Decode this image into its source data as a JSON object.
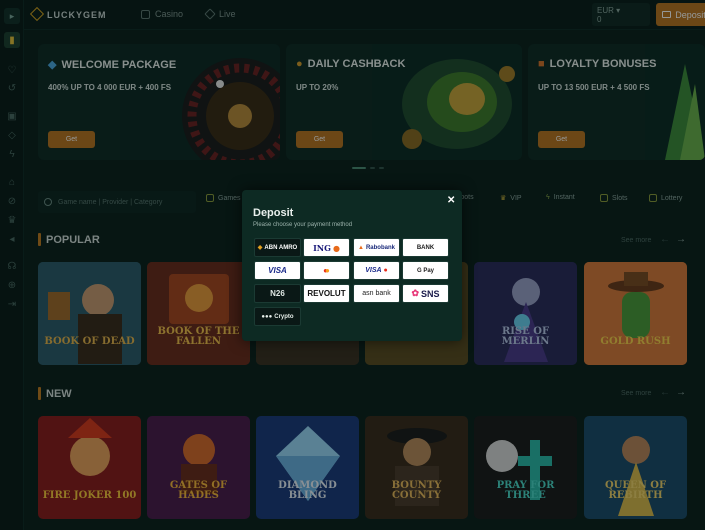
{
  "app": {
    "logo_text": "LUCKYGEM"
  },
  "topnav": [
    {
      "label": "Casino",
      "icon": "casino-icon"
    },
    {
      "label": "Live",
      "icon": "live-icon"
    }
  ],
  "account": {
    "currency": "EUR",
    "balance": "0"
  },
  "header": {
    "deposit_label": "Deposit"
  },
  "promos": [
    {
      "title": "WELCOME PACKAGE",
      "subtitle": "400% UP TO 4 000 EUR + 400 FS",
      "cta": "Get",
      "icon": "gem-icon"
    },
    {
      "title": "DAILY CASHBACK",
      "subtitle": "UP TO 20%",
      "cta": "Get",
      "icon": "money-bag-icon"
    },
    {
      "title": "LOYALTY BONUSES",
      "subtitle": "UP TO 13 500 EUR + 4 500 FS",
      "cta": "Get",
      "icon": "gift-icon"
    }
  ],
  "search": {
    "placeholder": "Game name | Provider | Category"
  },
  "filters": [
    {
      "label": "Games"
    },
    {
      "label": "Jackpots"
    },
    {
      "label": "VIP"
    },
    {
      "label": "Instant"
    },
    {
      "label": "Slots"
    },
    {
      "label": "Lottery"
    }
  ],
  "sections": {
    "popular": {
      "title": "POPULAR",
      "see_more": "See more",
      "games": [
        "BOOK OF DEAD",
        "BOOK OF THE FALLEN",
        "",
        "",
        "RISE OF MERLIN",
        "GOLD RUSH"
      ]
    },
    "new": {
      "title": "NEW",
      "see_more": "See more",
      "games": [
        "FIRE JOKER 100",
        "GATES OF HADES",
        "DIAMOND BLING",
        "BOUNTY COUNTY",
        "PRAY FOR THREE",
        "QUEEN OF REBIRTH"
      ]
    }
  },
  "modal": {
    "title": "Deposit",
    "subtitle": "Please choose your payment method",
    "methods": [
      "ABN AMRO",
      "ING",
      "Rabobank",
      "BANK",
      "VISA",
      "Mastercard",
      "VISA",
      "G Pay",
      "N26",
      "REVOLUT",
      "asn bank",
      "SNS",
      "Crypto"
    ]
  },
  "colors": {
    "accent": "#b8741f",
    "background": "#0b1f1b",
    "modal": "#0d2a23"
  }
}
